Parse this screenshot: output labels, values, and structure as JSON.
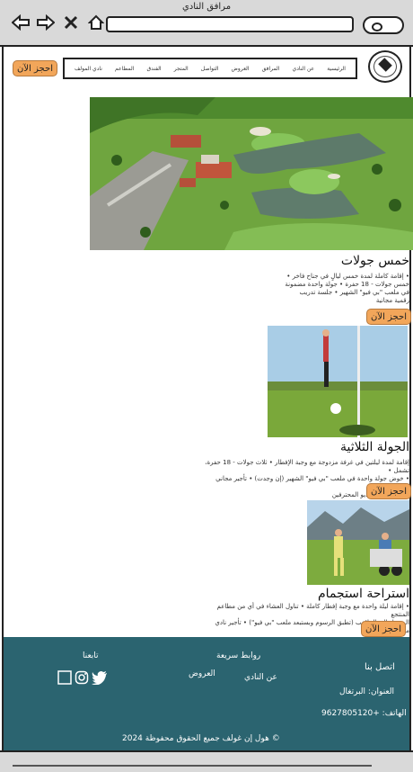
{
  "browser": {
    "title": "مرافق النادي",
    "back_icon": "arrow-left-icon",
    "forward_icon": "arrow-right-icon",
    "close_icon": "close-icon",
    "home_icon": "home-icon",
    "search_icon": "search-icon"
  },
  "header": {
    "book_label": "احجز الآن",
    "menu": [
      "الرئيسية",
      "عن النادي",
      "المرافق",
      "العروض",
      "التواصل",
      "المتجر",
      "الفندق",
      "المطاعم",
      "نادي المولف"
    ]
  },
  "sections": [
    {
      "title": "خمس جولات",
      "lines": [
        "• إقامة كاملة لمدة خمس ليالٍ في جناح فاخر •",
        "خمس جولات - 18 حفرة • جولة واحدة مضمونة",
        "في ملعب \"بي فيو\" الشهير • جلسة تدريب",
        "رقمية مجانية"
      ],
      "book_label": "احجز الآن"
    },
    {
      "title": "الجولة الثلاثية",
      "lines": [
        "إقامة لمدة ليلتين في غرفة مزدوجة مع وجبة الإفطار • ثلاث جولات - 18 حفرة، تشمل •",
        "• خوض جولة واحدة في ملعب \"بي فيو\" الشهير (إن وجدت) • تأجير مجاني للعربات",
        "خصم 25 % ستديو المحترفين"
      ],
      "book_label": "احجز الآن"
    },
    {
      "title": "استراحة استجمام",
      "lines": [
        "• إقامة ليلة واحدة مع وجبة إفطار كاملة • تناول العشاء في أي من مطاعم المنتجع",
        "الوصول إلى الملاعب (تطبق الرسوم وبستبعد ملعب \"بي فيو\")  • تأجير نادي مجاني"
      ],
      "book_label": "احجز الآن"
    }
  ],
  "footer": {
    "contact_title": "اتصل بنا",
    "address": "العنوان: البرتغال",
    "phone": "الهاتف: +9627805120",
    "quick_links_title": "روابط سريعة",
    "link_about": "عن النادي",
    "link_offers": "العروض",
    "follow_title": "تابعنا",
    "social_icons": [
      "twitter-icon",
      "instagram-icon",
      "square-icon"
    ],
    "copyright": "هول إن غولف جميع الحقوق محفوظة 2024 ©"
  },
  "colors": {
    "accent": "#f2a65a",
    "footer_bg": "#2b6470",
    "chrome_bg": "#d9d9d9"
  }
}
